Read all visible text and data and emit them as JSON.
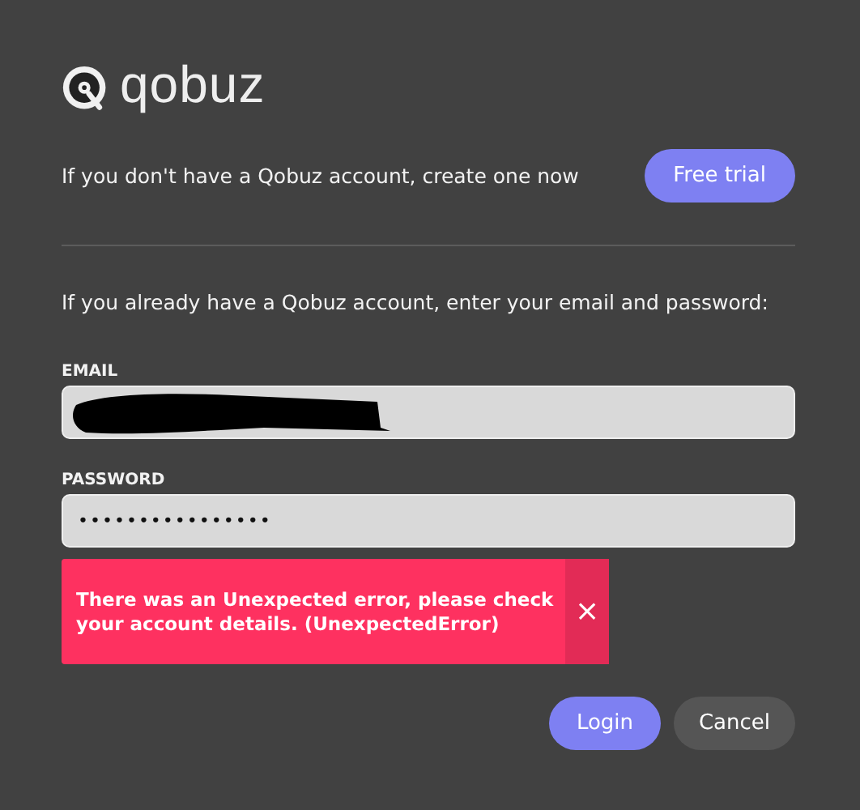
{
  "logo": {
    "wordmark": "qobuz"
  },
  "signup": {
    "text": "If you don't have a Qobuz account, create one now",
    "button": "Free trial"
  },
  "login_intro": "If you already have a Qobuz account, enter your email and password:",
  "email": {
    "label": "EMAIL",
    "redacted": true
  },
  "password": {
    "label": "PASSWORD",
    "value": "••••••••••••••••"
  },
  "error": {
    "message": "There was an Unexpected error, please check your account details. (UnexpectedError)",
    "close": "×"
  },
  "buttons": [
    {
      "label": "Login",
      "kind": "primary"
    },
    {
      "label": "Cancel",
      "kind": "secondary"
    }
  ]
}
